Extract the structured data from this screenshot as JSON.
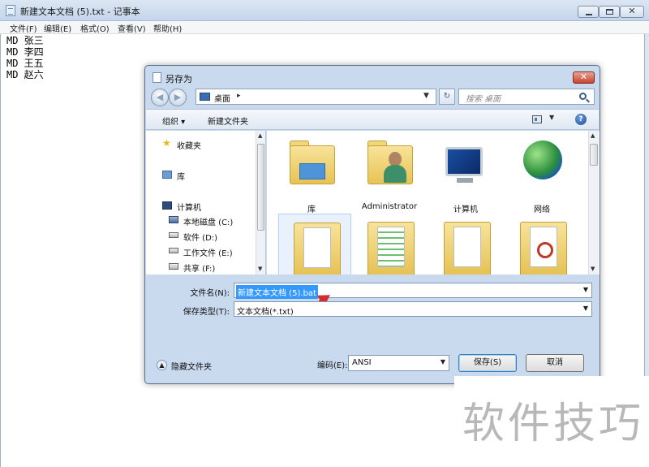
{
  "notepad": {
    "title": "新建文本文档 (5).txt - 记事本",
    "menu": [
      "文件(F)",
      "编辑(E)",
      "格式(O)",
      "查看(V)",
      "帮助(H)"
    ],
    "lines": [
      "MD 张三",
      "MD 李四",
      "MD 王五",
      "MD 赵六"
    ]
  },
  "dialog": {
    "title": "另存为",
    "address": {
      "location": "桌面",
      "separator": "▸"
    },
    "search_placeholder": "搜索 桌面",
    "toolbar": {
      "organize": "组织 ▾",
      "new_folder": "新建文件夹"
    },
    "nav": {
      "favorites": "收藏夹",
      "libraries": "库",
      "computer": "计算机",
      "drives": [
        "本地磁盘 (C:)",
        "软件 (D:)",
        "工作文件 (E:)",
        "共享 (F:)"
      ]
    },
    "files": [
      "库",
      "Administrator",
      "计算机",
      "网络"
    ],
    "filename_label": "文件名(N):",
    "filename_value": "新建文本文档 (5).bat",
    "filetype_label": "保存类型(T):",
    "filetype_value": "文本文档(*.txt)",
    "hide_folders": "隐藏文件夹",
    "encoding_label": "编码(E):",
    "encoding_value": "ANSI",
    "save_button": "保存(S)",
    "cancel_button": "取消"
  },
  "watermark": "软件技巧",
  "colors": {
    "selection": "#3399ff",
    "arrow": "#d42d2d",
    "dialog_frame": "#c9d9ee"
  }
}
